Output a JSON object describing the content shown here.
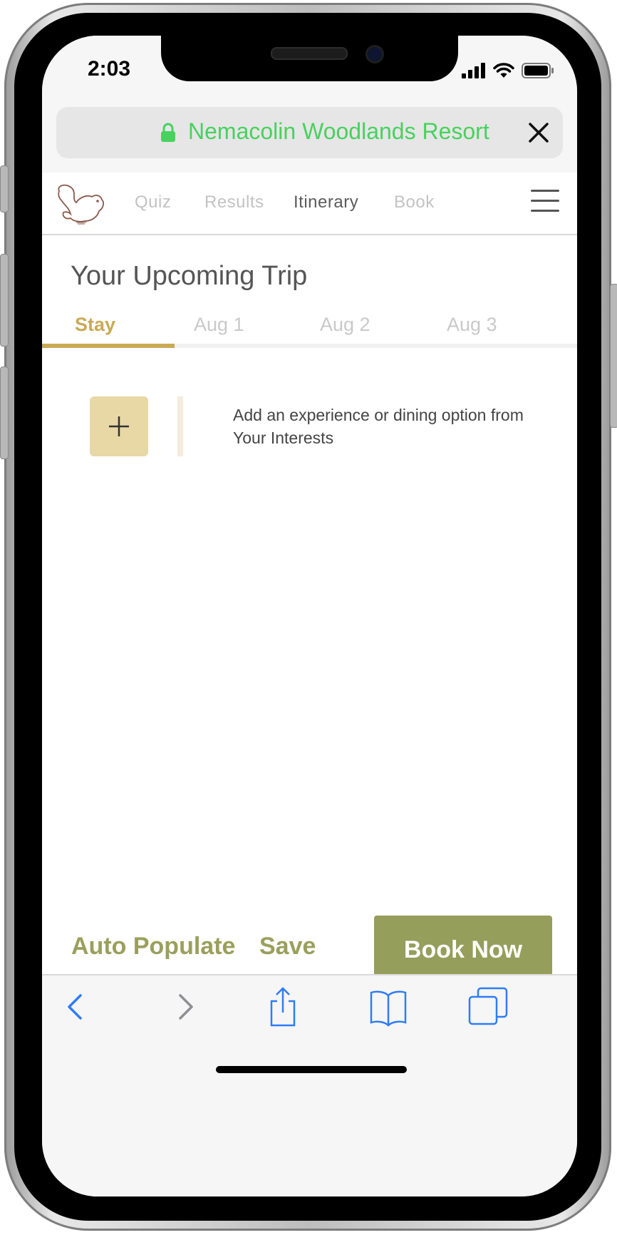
{
  "status_bar": {
    "time": "2:03"
  },
  "browser": {
    "url_text": "Nemacolin Woodlands Resort",
    "url_color": "#48d15f"
  },
  "nav": {
    "items": [
      "Quiz",
      "Results",
      "Itinerary",
      "Book"
    ],
    "active": "Itinerary"
  },
  "page": {
    "title": "Your Upcoming Trip",
    "tabs": [
      "Stay",
      "Aug 1",
      "Aug 2",
      "Aug 3"
    ],
    "active_tab": "Stay",
    "add_prompt": "Add an experience or dining option from Your Interests"
  },
  "actions": {
    "auto_populate": "Auto Populate",
    "save": "Save",
    "book_now": "Book Now"
  },
  "colors": {
    "accent_gold": "#c9aa55",
    "add_button_bg": "#e7d8a6",
    "action_green": "#969e5b"
  },
  "icons": {
    "status": [
      "cellular-signal-icon",
      "wifi-icon",
      "battery-icon"
    ],
    "browser": [
      "lock-icon",
      "close-icon"
    ],
    "toolbar": [
      "back-icon",
      "forward-icon",
      "share-icon",
      "bookmarks-icon",
      "tabs-icon"
    ]
  }
}
